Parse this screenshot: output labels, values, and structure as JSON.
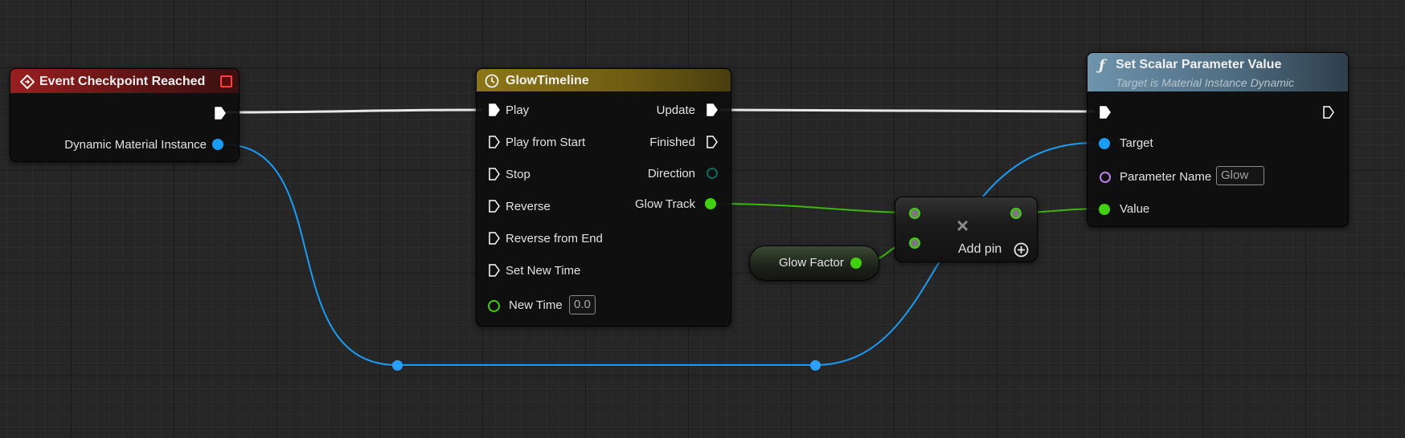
{
  "colors": {
    "exec": "#ffffff",
    "object_pin": "#1b9cf4",
    "float_pin": "#40d010",
    "name_pin": "#c080f0",
    "event_header": "#8f1c1c",
    "timeline_header": "#8a7418",
    "function_header": "#5c7e96"
  },
  "event_node": {
    "title": "Event Checkpoint Reached",
    "title_icon": "event-diamond-icon",
    "output_pin_label": "Dynamic Material Instance"
  },
  "timeline_node": {
    "title": "GlowTimeline",
    "title_icon": "clock-icon",
    "inputs": [
      "Play",
      "Play from Start",
      "Stop",
      "Reverse",
      "Reverse from End",
      "Set New Time"
    ],
    "new_time_label": "New Time",
    "new_time_value": "0.0",
    "outputs": [
      "Update",
      "Finished",
      "Direction",
      "Glow Track"
    ]
  },
  "glow_factor_node": {
    "label": "Glow Factor"
  },
  "multiply_node": {
    "symbol": "×",
    "add_pin_label": "Add pin",
    "add_pin_icon": "plus-circle-icon"
  },
  "set_param_node": {
    "title": "Set Scalar Parameter Value",
    "subtitle": "Target is Material Instance Dynamic",
    "title_icon": "function-f-icon",
    "target_label": "Target",
    "param_name_label": "Parameter Name",
    "param_name_value": "Glow",
    "value_label": "Value"
  }
}
